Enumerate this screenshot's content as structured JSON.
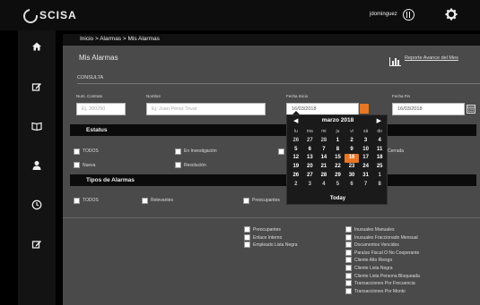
{
  "header": {
    "brand": "SCISA",
    "user": "jdominguez"
  },
  "breadcrumb": "Inicio > Alarmas > Mis Alarmas",
  "page_title": "Mis Alarmas",
  "report_link": "Reporte Avance del Mes",
  "consulta": {
    "section": "CONSULTA",
    "contract_label": "Num. Contrato",
    "contract_placeholder": "Ej. 200290",
    "name_label": "Nombre",
    "name_placeholder": "Ej. Juan Pérez Tovar",
    "start_label": "Fecha Inicio",
    "start_value": "16/03/2018",
    "end_label": "Fecha Fin",
    "end_value": "16/03/2018"
  },
  "estatus": {
    "title": "Estatus",
    "options": [
      "TODOS",
      "En Investigación",
      "Cerrada",
      "Nueva",
      "Resolución"
    ]
  },
  "tipos": {
    "title": "Tipos de Alarmas",
    "options": [
      "TODOS",
      "Relevantes",
      "Preocupantes"
    ]
  },
  "types_left": [
    "Preocupantes",
    "Enlace Interno",
    "Empleado Lista Negra"
  ],
  "types_right": [
    "Inusuales Manuales",
    "Inusuales Fraccionado Mensual",
    "Documentos Vencidos",
    "Paraíso Fiscal O No Cooperante",
    "Cliente Alto Riesgo",
    "Cliente Lista Negra",
    "Cliente Lista Persona Bloqueada",
    "Transacciones Por Frecuencia",
    "Transacciones Por Monto"
  ],
  "datepicker": {
    "month": "marzo 2018",
    "prev": "◀",
    "next": "▶",
    "dow": [
      "lu",
      "ma",
      "mi",
      "ju",
      "vi",
      "sá",
      "do"
    ],
    "weeks": [
      [
        "26",
        "27",
        "28",
        "1",
        "2",
        "3",
        "4"
      ],
      [
        "5",
        "6",
        "7",
        "8",
        "9",
        "10",
        "11"
      ],
      [
        "12",
        "13",
        "14",
        "15",
        "16",
        "17",
        "18"
      ],
      [
        "19",
        "20",
        "21",
        "22",
        "23",
        "24",
        "25"
      ],
      [
        "26",
        "27",
        "28",
        "29",
        "30",
        "31",
        "1"
      ],
      [
        "2",
        "3",
        "4",
        "5",
        "6",
        "7",
        "8"
      ]
    ],
    "selected": "16",
    "today": "Today"
  },
  "colors": {
    "accent": "#e87722",
    "main_bg": "#4a4a4a",
    "bar_bg": "#0b0b0b"
  }
}
